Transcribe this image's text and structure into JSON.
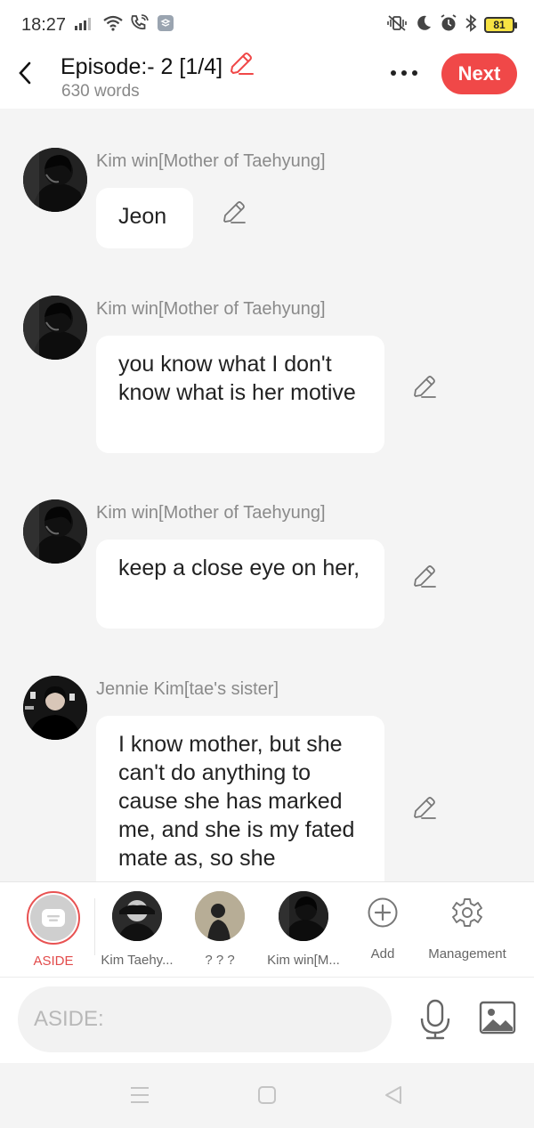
{
  "status_bar": {
    "time": "18:27",
    "battery": "81",
    "left_icons": [
      "signal-icon",
      "wifi-icon",
      "wifi-calling-icon",
      "app-notification-icon"
    ],
    "right_icons": [
      "vibrate-icon",
      "do-not-disturb-icon",
      "alarm-icon",
      "bluetooth-icon",
      "battery-icon"
    ]
  },
  "header": {
    "title": "Episode:- 2 [1/4]",
    "word_count": "630 words",
    "next_label": "Next"
  },
  "messages": [
    {
      "speaker": "Kim win[Mother of Taehyung]",
      "text": "Jeon"
    },
    {
      "speaker": "Kim win[Mother of Taehyung]",
      "text": "you know what I don't know what is her motive"
    },
    {
      "speaker": "Kim win[Mother of Taehyung]",
      "text": "keep a close eye on her,"
    },
    {
      "speaker": "Jennie Kim[tae's sister]",
      "text": "I know mother, but she can't do anything to cause she has marked me, and she is my fated mate as, so she"
    }
  ],
  "characters": [
    {
      "label": "ASIDE",
      "active": true
    },
    {
      "label": "Kim Taehy..."
    },
    {
      "label": "? ? ?"
    },
    {
      "label": "Kim win[M..."
    },
    {
      "label": "Add"
    },
    {
      "label": "Management"
    }
  ],
  "input": {
    "placeholder": "ASIDE:"
  },
  "colors": {
    "accent": "#f04848",
    "background": "#f4f4f4"
  }
}
